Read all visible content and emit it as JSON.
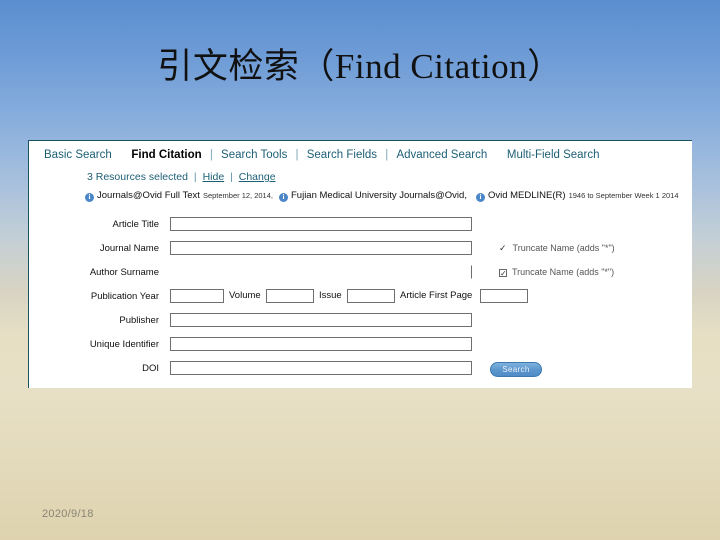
{
  "slide": {
    "title": "引文检索（Find Citation）",
    "date": "2020/9/18"
  },
  "screenshot": {
    "tabs": [
      {
        "label": "Basic Search",
        "active": false,
        "sep_after": false
      },
      {
        "label": "Find Citation",
        "active": true,
        "sep_after": true
      },
      {
        "label": "Search Tools",
        "active": false,
        "sep_after": true
      },
      {
        "label": "Search Fields",
        "active": false,
        "sep_after": true
      },
      {
        "label": "Advanced Search",
        "active": false,
        "sep_after": false
      },
      {
        "label": "Multi-Field Search",
        "active": false,
        "sep_after": false
      }
    ],
    "resources_line": {
      "count_text": "3 Resources selected",
      "hide_label": "Hide",
      "change_label": "Change",
      "separator": "|"
    },
    "resources": [
      {
        "icon": "info-icon",
        "name": "Journals@Ovid Full Text",
        "detail": "September 12, 2014,"
      },
      {
        "icon": "info-icon",
        "name": "Fujian Medical University Journals@Ovid,",
        "detail": ""
      },
      {
        "icon": "info-icon",
        "name": "Ovid MEDLINE(R)",
        "detail": "1946 to September Week 1 2014"
      }
    ],
    "form": {
      "article_title_label": "Article Title",
      "journal_name_label": "Journal Name",
      "author_surname_label": "Author Surname",
      "publication_year_label": "Publication Year",
      "volume_label": "Volume",
      "issue_label": "Issue",
      "article_first_page_label": "Article First Page",
      "publisher_label": "Publisher",
      "unique_identifier_label": "Unique Identifier",
      "doi_label": "DOI",
      "truncate_journal_label": "Truncate Name (adds \"*\")",
      "truncate_author_label": "Truncate Name (adds \"*\")",
      "truncate_author_checked": "✓",
      "truncate_journal_checked": "✓",
      "values": {
        "article_title": "",
        "journal_name": "",
        "author_surname": "",
        "publication_year": "",
        "volume": "",
        "issue": "",
        "article_first_page": "",
        "publisher": "",
        "unique_identifier": "",
        "doi": ""
      },
      "search_button": "Search"
    }
  },
  "colors": {
    "link": "#1c5f75",
    "accent_button": "#5d97cd",
    "info_icon": "#4a86c8",
    "background_top": "#5b8ed0",
    "background_bottom": "#ded3ae"
  }
}
